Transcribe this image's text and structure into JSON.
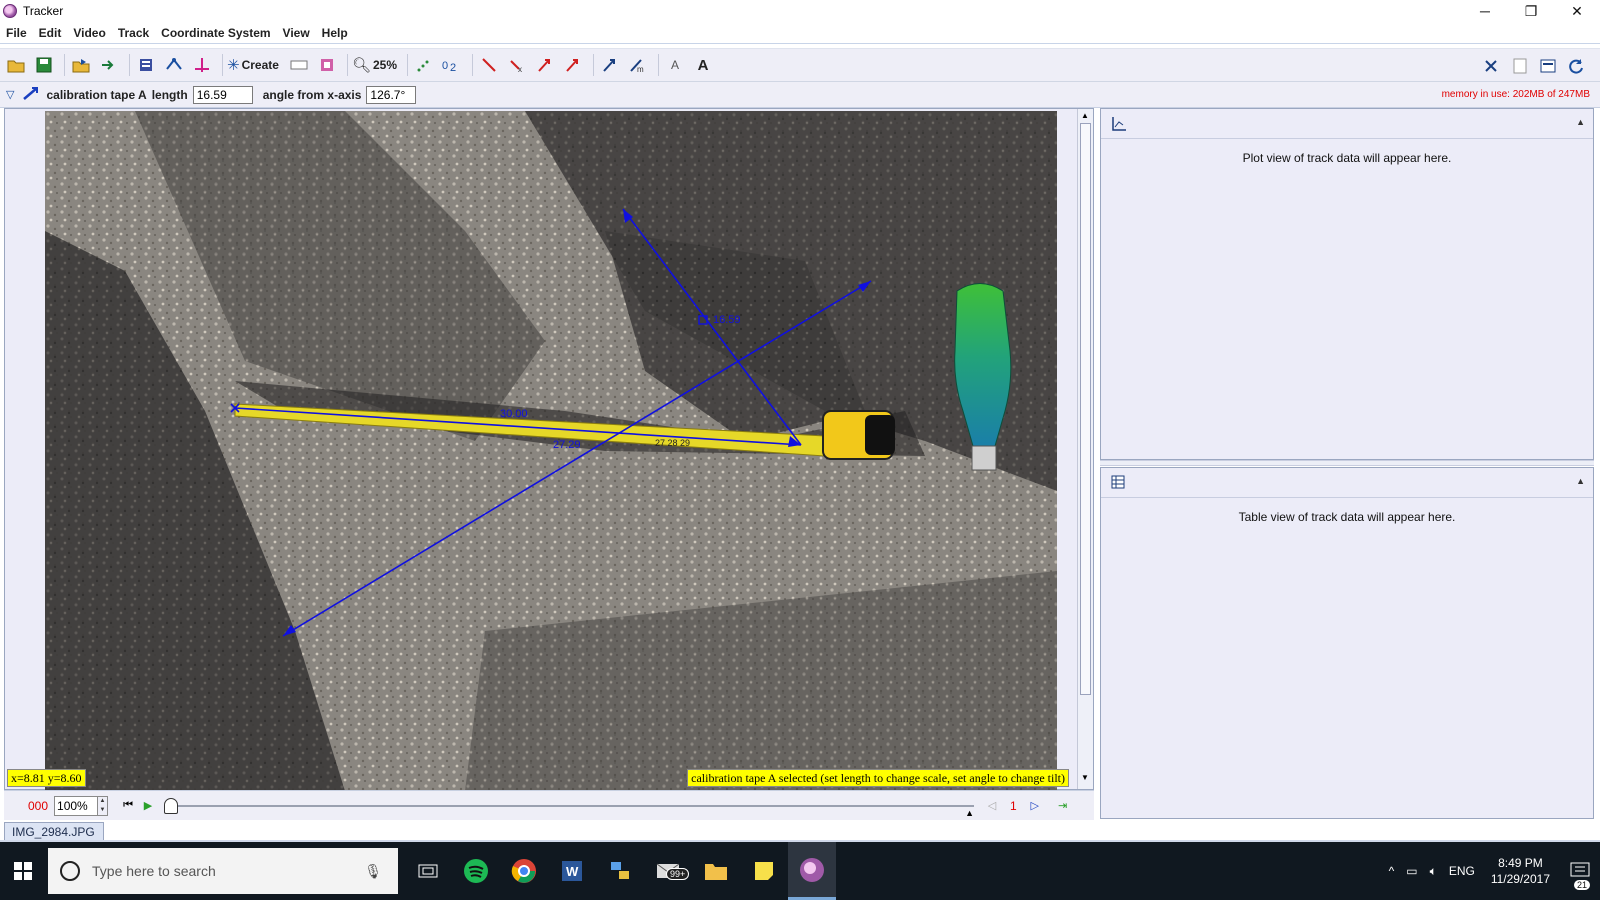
{
  "window": {
    "title": "Tracker",
    "minimize": "─",
    "maximize": "❐",
    "close": "✕"
  },
  "menu": [
    "File",
    "Edit",
    "Video",
    "Track",
    "Coordinate System",
    "View",
    "Help"
  ],
  "toolbar": {
    "create_label": "Create",
    "zoom_label": "25%"
  },
  "trackbar": {
    "track_name": "calibration tape A",
    "length_label": "length",
    "length_value": "16.59",
    "angle_label": "angle from x-axis",
    "angle_value": "126.7°",
    "memory": "memory in use: 202MB of 247MB"
  },
  "video": {
    "coord_readout": "x=8.81  y=8.60",
    "status_message": "calibration tape A selected (set length to change scale, set angle to change tilt)",
    "tape_label_top": "30.00",
    "tape_label_bottom": "27.29",
    "short_tape_label": "16.59",
    "tape_ticks": "27 28 29"
  },
  "player": {
    "frame": "000",
    "rate": "100%",
    "step": "1"
  },
  "file_tab": "IMG_2984.JPG",
  "plot_panel": {
    "message": "Plot view of track data will appear here."
  },
  "table_panel": {
    "message": "Table view of track data will appear here."
  },
  "taskbar": {
    "search_placeholder": "Type here to search",
    "mail_badge": "99+",
    "lang": "ENG",
    "time": "8:49 PM",
    "date": "11/29/2017",
    "notif_count": "21"
  },
  "colors": {
    "accent": "#1a4fa0",
    "highlight": "#ffff00",
    "warning": "#e00000",
    "axis": "#1010e0"
  }
}
